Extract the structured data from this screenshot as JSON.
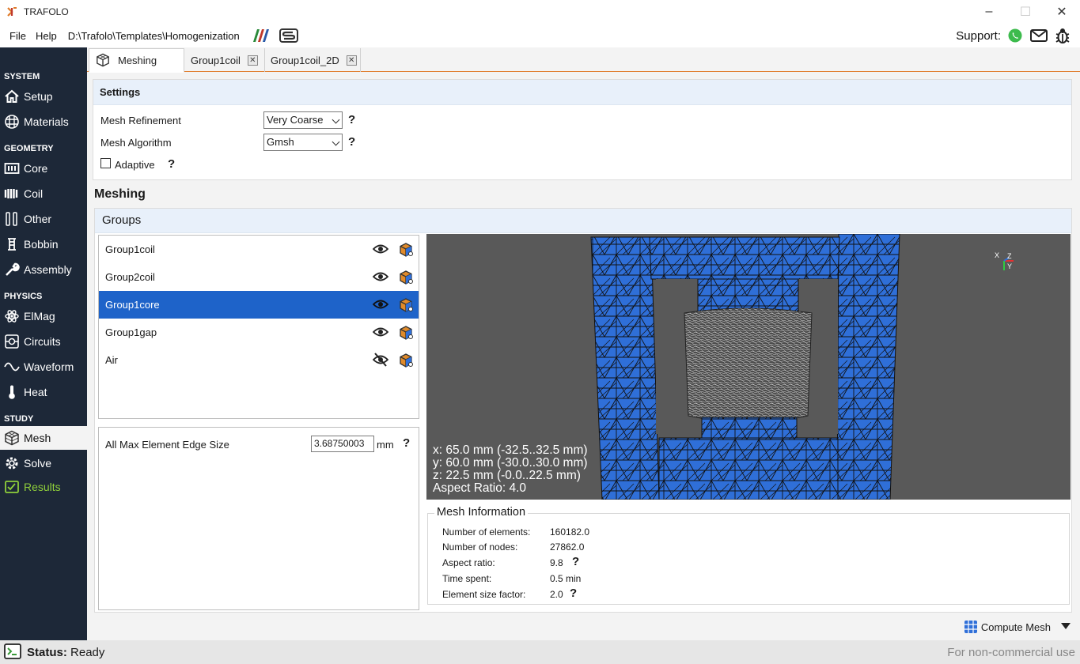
{
  "window": {
    "title": "TRAFOLO",
    "minimize_icon": "minimize-icon",
    "maximize_icon": "maximize-icon",
    "close_icon": "close-icon"
  },
  "menu": {
    "file": "File",
    "help": "Help",
    "path": "D:\\Trafolo\\Templates\\Homogenization",
    "support_label": "Support:"
  },
  "sidebar": {
    "sections": {
      "system": "SYSTEM",
      "geometry": "GEOMETRY",
      "physics": "PHYSICS",
      "study": "STUDY"
    },
    "items": [
      {
        "label": "Setup",
        "icon": "home-icon"
      },
      {
        "label": "Materials",
        "icon": "materials-icon"
      },
      {
        "label": "Core",
        "icon": "core-icon"
      },
      {
        "label": "Coil",
        "icon": "coil-icon"
      },
      {
        "label": "Other",
        "icon": "other-icon"
      },
      {
        "label": "Bobbin",
        "icon": "bobbin-icon"
      },
      {
        "label": "Assembly",
        "icon": "wrench-icon"
      },
      {
        "label": "ElMag",
        "icon": "atom-icon"
      },
      {
        "label": "Circuits",
        "icon": "circuit-icon"
      },
      {
        "label": "Waveform",
        "icon": "wave-icon"
      },
      {
        "label": "Heat",
        "icon": "thermometer-icon"
      },
      {
        "label": "Mesh",
        "icon": "mesh-cube-icon"
      },
      {
        "label": "Solve",
        "icon": "gear-icon"
      },
      {
        "label": "Results",
        "icon": "results-icon"
      }
    ],
    "results_color": "#8fcf3a"
  },
  "tabs": [
    {
      "label": "Meshing"
    },
    {
      "label": "Group1coil"
    },
    {
      "label": "Group1coil_2D"
    }
  ],
  "settings": {
    "header": "Settings",
    "mesh_refinement_label": "Mesh Refinement",
    "mesh_refinement_value": "Very Coarse",
    "mesh_algorithm_label": "Mesh Algorithm",
    "mesh_algorithm_value": "Gmsh",
    "adaptive_label": "Adaptive",
    "adaptive_checked": false,
    "help_mark": "?"
  },
  "meshing": {
    "title": "Meshing",
    "groups_header": "Groups",
    "groups": [
      {
        "name": "Group1coil",
        "visible": true
      },
      {
        "name": "Group2coil",
        "visible": true
      },
      {
        "name": "Group1core",
        "visible": true,
        "selected": true
      },
      {
        "name": "Group1gap",
        "visible": true
      },
      {
        "name": "Air",
        "visible": false
      }
    ],
    "edge_size_label": "All Max Element Edge Size",
    "edge_size_value": "3.68750003",
    "edge_size_unit": "mm"
  },
  "viewport": {
    "dims": {
      "x": "x: 65.0 mm (-32.5..32.5 mm)",
      "y": "y: 60.0 mm (-30.0..30.0 mm)",
      "z": "z: 22.5 mm (-0.0..22.5 mm)",
      "aspect": "Aspect Ratio: 4.0"
    },
    "axis": {
      "x": "X",
      "z": "Z",
      "y": "Y"
    },
    "mesh_color": "#2f6fd8",
    "background_color": "#595959"
  },
  "mesh_info": {
    "title": "Mesh Information",
    "rows": [
      {
        "label": "Number of elements:",
        "value": "160182.0"
      },
      {
        "label": "Number of nodes:",
        "value": "27862.0"
      },
      {
        "label": "Aspect ratio:",
        "value": "9.8"
      },
      {
        "label": "Time spent:",
        "value": "0.5 min"
      },
      {
        "label": "Element size factor:",
        "value": "2.0"
      }
    ]
  },
  "toolbar": {
    "compute_label": "Compute Mesh"
  },
  "status": {
    "label": "Status:",
    "value": "Ready",
    "license": "For non-commercial use"
  },
  "colors": {
    "sidebar_bg": "#1d2838",
    "selection": "#1e63c9",
    "accent_orange": "#e07b2a",
    "panel_header": "#e8f0fa"
  }
}
